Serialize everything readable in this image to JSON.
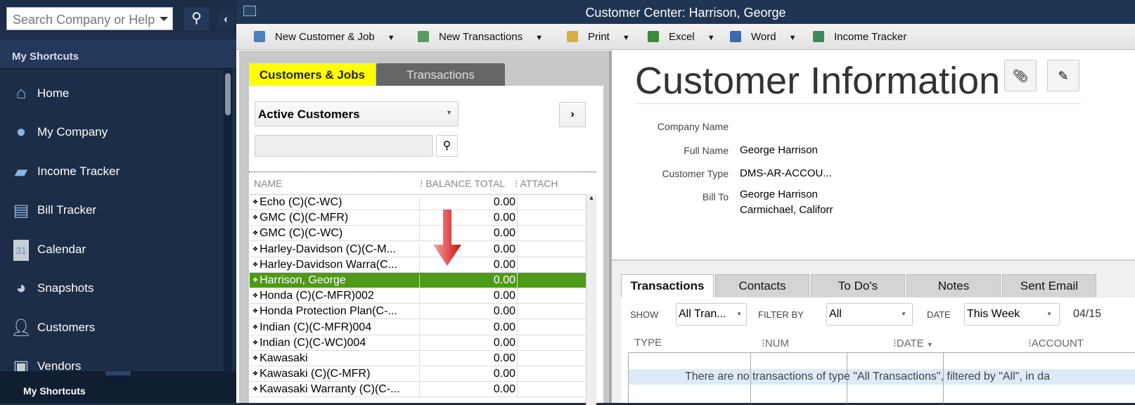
{
  "sidebar": {
    "search_placeholder": "Search Company or Help",
    "header": "My Shortcuts",
    "footer": "My Shortcuts",
    "items": [
      {
        "label": "Home",
        "icon": "home-icon"
      },
      {
        "label": "My Company",
        "icon": "my-company-icon"
      },
      {
        "label": "Income Tracker",
        "icon": "income-tracker-icon"
      },
      {
        "label": "Bill Tracker",
        "icon": "bill-tracker-icon"
      },
      {
        "label": "Calendar",
        "icon": "calendar-icon"
      },
      {
        "label": "Snapshots",
        "icon": "snapshots-icon"
      },
      {
        "label": "Customers",
        "icon": "customers-icon"
      },
      {
        "label": "Vendors",
        "icon": "vendors-icon"
      }
    ]
  },
  "window": {
    "title": "Customer Center: Harrison, George"
  },
  "toolbar": {
    "new_customer": "New Customer & Job",
    "new_transactions": "New Transactions",
    "print": "Print",
    "excel": "Excel",
    "word": "Word",
    "income_tracker": "Income Tracker"
  },
  "left": {
    "tabs": [
      "Customers & Jobs",
      "Transactions"
    ],
    "filter": "Active Customers",
    "search_value": "",
    "columns": [
      "NAME",
      "BALANCE TOTAL",
      "ATTACH"
    ],
    "rows": [
      {
        "name": "Echo (C)(C-WC)",
        "balance": "0.00"
      },
      {
        "name": "GMC (C)(C-MFR)",
        "balance": "0.00"
      },
      {
        "name": "GMC (C)(C-WC)",
        "balance": "0.00"
      },
      {
        "name": "Harley-Davidson (C)(C-M...",
        "balance": "0.00"
      },
      {
        "name": "Harley-Davidson Warra(C...",
        "balance": "0.00"
      },
      {
        "name": "Harrison, George",
        "balance": "0.00",
        "selected": true
      },
      {
        "name": "Honda (C)(C-MFR)002",
        "balance": "0.00"
      },
      {
        "name": "Honda Protection Plan(C-...",
        "balance": "0.00"
      },
      {
        "name": "Indian (C)(C-MFR)004",
        "balance": "0.00"
      },
      {
        "name": "Indian (C)(C-WC)004",
        "balance": "0.00"
      },
      {
        "name": "Kawasaki",
        "balance": "0.00"
      },
      {
        "name": "Kawasaki (C)(C-MFR)",
        "balance": "0.00"
      },
      {
        "name": "Kawasaki Warranty (C)(C-...",
        "balance": "0.00"
      }
    ],
    "highlight_color": "#ffff00",
    "selected_color": "#4e9a18"
  },
  "info": {
    "title": "Customer Information",
    "fields": [
      {
        "label": "Company Name",
        "value": ""
      },
      {
        "label": "Full Name",
        "value": "George  Harrison"
      },
      {
        "label": "Customer Type",
        "value": "DMS-AR-ACCOU..."
      },
      {
        "label": "Bill To",
        "value": "George Harrison",
        "value2": "Carmichael, Califorr"
      }
    ]
  },
  "bottom": {
    "tabs": [
      "Transactions",
      "Contacts",
      "To Do's",
      "Notes",
      "Sent Email"
    ],
    "show_label": "SHOW",
    "show_value": "All Tran...",
    "filter_label": "FILTER BY",
    "filter_value": "All",
    "date_label": "DATE",
    "date_value": "This Week",
    "date_range": "04/15",
    "columns": [
      "TYPE",
      "NUM",
      "DATE",
      "ACCOUNT"
    ],
    "empty_message": "There are no transactions of type \"All Transactions\", filtered by \"All\", in da"
  }
}
